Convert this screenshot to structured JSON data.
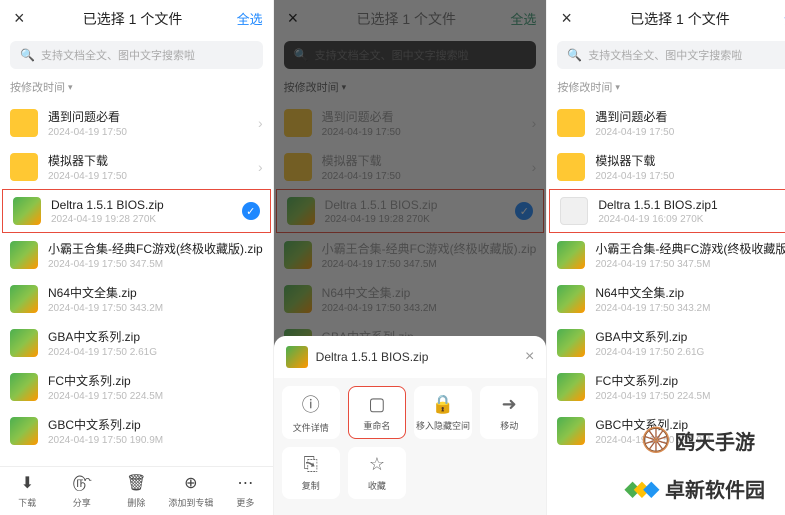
{
  "header": {
    "title": "已选择 1 个文件",
    "select_all": "全选",
    "close": "×"
  },
  "search": {
    "placeholder": "支持文档全文、图中文字搜索啦"
  },
  "sort": {
    "label": "按修改时间"
  },
  "files": [
    {
      "name": "遇到问题必看",
      "meta": "2024-04-19 17:50",
      "type": "folder"
    },
    {
      "name": "模拟器下载",
      "meta": "2024-04-19 17:50",
      "type": "folder"
    },
    {
      "name": "Deltra 1.5.1 BIOS.zip",
      "meta": "2024-04-19 19:28   270K",
      "type": "zip",
      "checked": true,
      "highlight": true
    },
    {
      "name": "小霸王合集-经典FC游戏(终极收藏版).zip",
      "meta": "2024-04-19 17:50   347.5M",
      "type": "zip"
    },
    {
      "name": "N64中文全集.zip",
      "meta": "2024-04-19 17:50   343.2M",
      "type": "zip"
    },
    {
      "name": "GBA中文系列.zip",
      "meta": "2024-04-19 17:50   2.61G",
      "type": "zip"
    },
    {
      "name": "FC中文系列.zip",
      "meta": "2024-04-19 17:50   224.5M",
      "type": "zip"
    },
    {
      "name": "GBC中文系列.zip",
      "meta": "2024-04-19 17:50   190.9M",
      "type": "zip"
    }
  ],
  "files_right": [
    {
      "name": "遇到问题必看",
      "meta": "2024-04-19 17:50",
      "type": "folder"
    },
    {
      "name": "模拟器下载",
      "meta": "2024-04-19 17:50",
      "type": "folder"
    },
    {
      "name": "Deltra 1.5.1 BIOS.zip1",
      "meta": "2024-04-19 16:09   270K",
      "type": "file",
      "checked": true,
      "highlight": true
    },
    {
      "name": "小霸王合集-经典FC游戏(终极收藏版).zip",
      "meta": "2024-04-19 17:50   347.5M",
      "type": "zip"
    },
    {
      "name": "N64中文全集.zip",
      "meta": "2024-04-19 17:50   343.2M",
      "type": "zip"
    },
    {
      "name": "GBA中文系列.zip",
      "meta": "2024-04-19 17:50   2.61G",
      "type": "zip"
    },
    {
      "name": "FC中文系列.zip",
      "meta": "2024-04-19 17:50   224.5M",
      "type": "zip"
    },
    {
      "name": "GBC中文系列.zip",
      "meta": "2024-04-19 17:50   190.9M",
      "type": "zip"
    }
  ],
  "toolbar": [
    {
      "icon": "⬇",
      "label": "下载"
    },
    {
      "icon": "௹",
      "label": "分享"
    },
    {
      "icon": "🗑",
      "label": "删除"
    },
    {
      "icon": "⊕",
      "label": "添加到专辑"
    },
    {
      "icon": "⋯",
      "label": "更多"
    }
  ],
  "sheet": {
    "filename": "Deltra 1.5.1 BIOS.zip",
    "actions": [
      {
        "icon": "ⓘ",
        "label": "文件详情"
      },
      {
        "icon": "▢",
        "label": "重命名",
        "highlight": true
      },
      {
        "icon": "🔒",
        "label": "移入隐藏空间"
      },
      {
        "icon": "➜",
        "label": "移动"
      },
      {
        "icon": "⎘",
        "label": "复制"
      },
      {
        "icon": "☆",
        "label": "收藏"
      }
    ]
  },
  "watermarks": {
    "wm1": "鸥天手游",
    "wm2": "卓新软件园"
  }
}
